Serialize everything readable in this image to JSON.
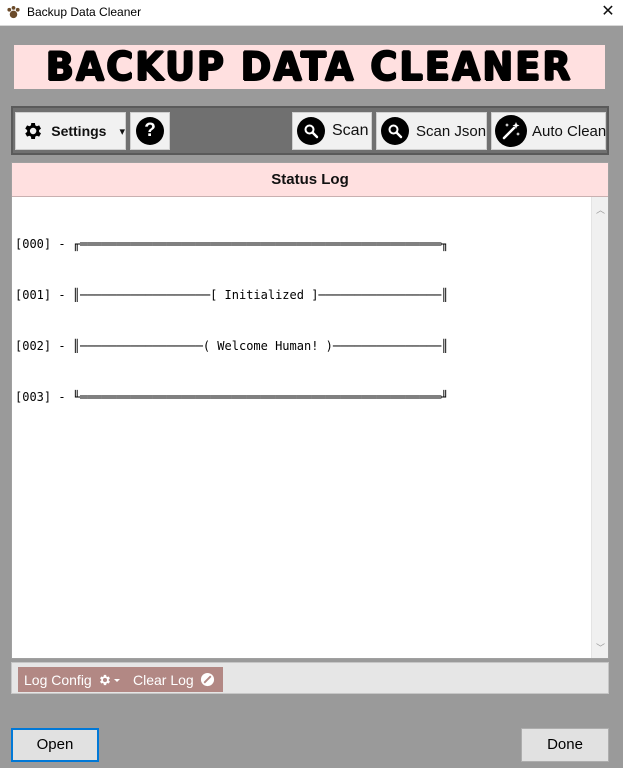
{
  "window": {
    "title": "Backup Data Cleaner",
    "close_glyph": "✕",
    "icon": "paw-icon"
  },
  "banner": {
    "text": "BACKUP DATA CLEANER"
  },
  "toolbar": {
    "settings": {
      "label": "Settings",
      "icon": "gear-icon",
      "dropdown": "▾"
    },
    "help": {
      "icon": "question-icon",
      "glyph": "?"
    },
    "scan": {
      "label": "Scan",
      "icon": "search-icon"
    },
    "scan_json": {
      "label": "Scan Json",
      "icon": "search-icon"
    },
    "auto_clean": {
      "label": "Auto Clean",
      "icon": "magic-wand-icon"
    }
  },
  "status": {
    "header": "Status Log",
    "lines": [
      "[000] - ╓══════════════════════════════════════════════════╖",
      "[001] - ║──────────────────[ Initialized ]─────────────────║",
      "[002] - ║─────────────────( Welcome Human! )───────────────║",
      "[003] - ╙══════════════════════════════════════════════════╜"
    ]
  },
  "bottom": {
    "log_config": {
      "label": "Log Config",
      "icon": "gear-icon"
    },
    "clear_log": {
      "label": "Clear Log",
      "icon": "clear-icon"
    }
  },
  "dialog": {
    "open_label": "Open",
    "done_label": "Done"
  },
  "colors": {
    "accent_pink": "#ffe0e0",
    "button_rose": "#b28884",
    "focus_blue": "#0078d7",
    "toolbar_grey": "#707070"
  }
}
